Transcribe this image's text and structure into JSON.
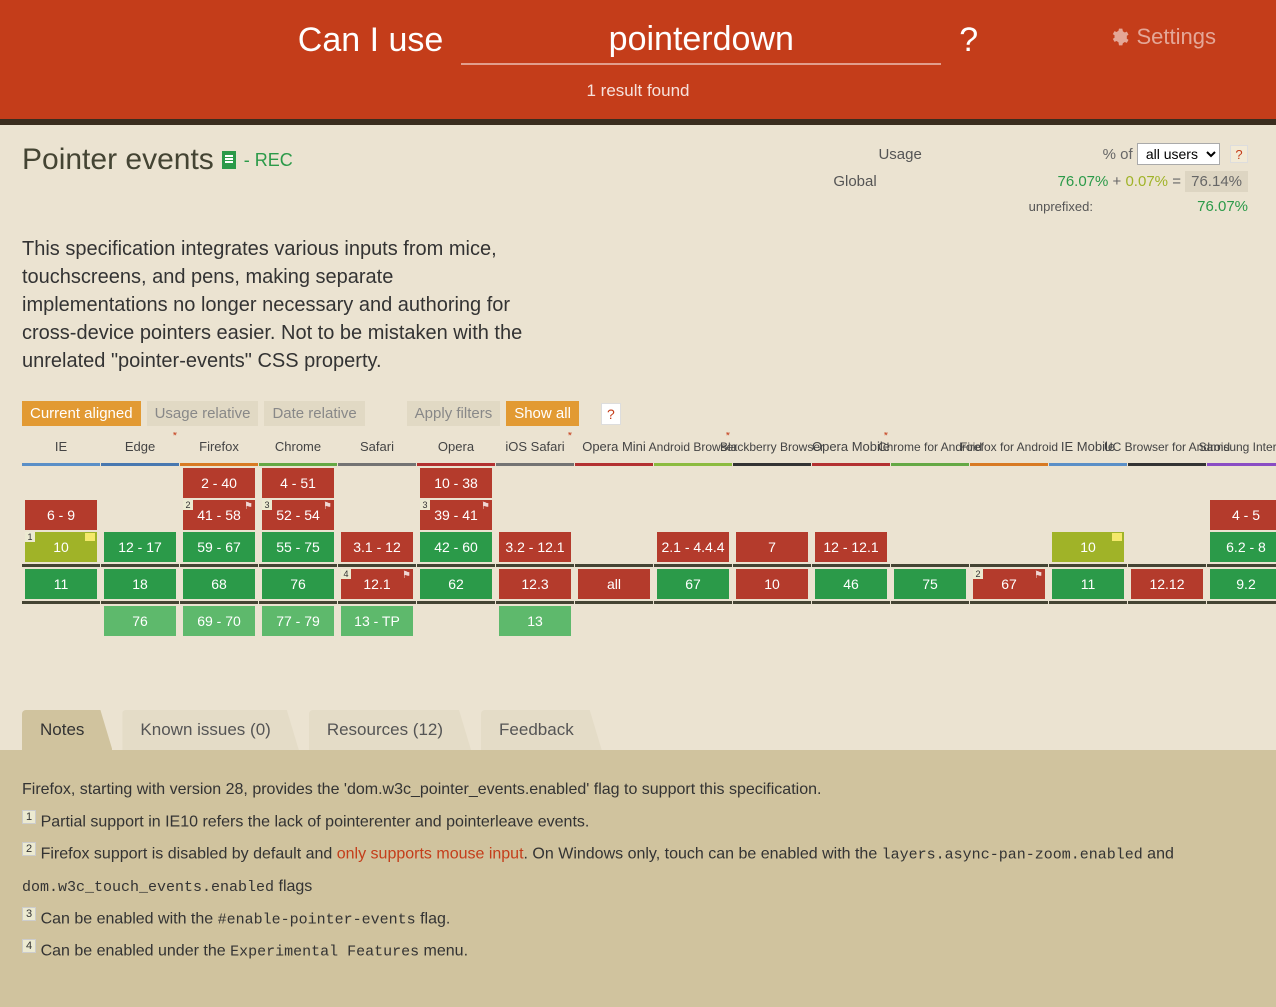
{
  "header": {
    "title_prefix": "Can I use",
    "search_value": "pointerdown",
    "qmark": "?",
    "settings_label": "Settings",
    "result_text": "1 result found"
  },
  "feature": {
    "title": "Pointer events",
    "status": "- REC",
    "description": "This specification integrates various inputs from mice, touchscreens, and pens, making separate implementations no longer necessary and authoring for cross-device pointers easier. Not to be mistaken with the unrelated \"pointer-events\" CSS property."
  },
  "usage": {
    "label": "Usage",
    "pct_of": "% of",
    "select_value": "all users",
    "help": "?",
    "global_label": "Global",
    "global_pct": "76.07%",
    "plus": "+",
    "prefix_pct": "0.07%",
    "eq": "=",
    "total_pct": "76.14%",
    "unprefixed_label": "unprefixed:",
    "unprefixed_pct": "76.07%"
  },
  "toolbar": {
    "current_aligned": "Current aligned",
    "usage_relative": "Usage relative",
    "date_relative": "Date relative",
    "apply_filters": "Apply filters",
    "show_all": "Show all",
    "help": "?"
  },
  "browsers": [
    {
      "name": "IE",
      "cls": "bc-ie",
      "star": false,
      "rows": [
        "",
        "6 - 9",
        "10",
        "11",
        ""
      ],
      "colors": [
        "empty",
        "red",
        "olive",
        "green",
        "empty"
      ],
      "marks": {
        "2": [
          "note:1",
          "minus"
        ]
      }
    },
    {
      "name": "Edge",
      "cls": "bc-edge",
      "star": true,
      "rows": [
        "",
        "",
        "12 - 17",
        "18",
        "76"
      ],
      "colors": [
        "empty",
        "empty",
        "green",
        "green",
        "lightgreen"
      ],
      "marks": {}
    },
    {
      "name": "Firefox",
      "cls": "bc-ff",
      "star": false,
      "rows": [
        "2 - 40",
        "41 - 58",
        "59 - 67",
        "68",
        "69 - 70"
      ],
      "colors": [
        "red",
        "red",
        "green",
        "green",
        "lightgreen"
      ],
      "marks": {
        "1": [
          "note:2",
          "flag"
        ]
      }
    },
    {
      "name": "Chrome",
      "cls": "bc-chrome",
      "star": false,
      "rows": [
        "4 - 51",
        "52 - 54",
        "55 - 75",
        "76",
        "77 - 79"
      ],
      "colors": [
        "red",
        "red",
        "green",
        "green",
        "lightgreen"
      ],
      "marks": {
        "1": [
          "note:3",
          "flag"
        ]
      }
    },
    {
      "name": "Safari",
      "cls": "bc-safari",
      "star": false,
      "rows": [
        "",
        "",
        "3.1 - 12",
        "12.1",
        "13 - TP"
      ],
      "colors": [
        "empty",
        "empty",
        "red",
        "red",
        "lightgreen"
      ],
      "marks": {
        "3": [
          "note:4",
          "flag"
        ]
      }
    },
    {
      "name": "Opera",
      "cls": "bc-opera",
      "star": false,
      "rows": [
        "10 - 38",
        "39 - 41",
        "42 - 60",
        "62",
        ""
      ],
      "colors": [
        "red",
        "red",
        "green",
        "green",
        "empty"
      ],
      "marks": {
        "1": [
          "note:3",
          "flag"
        ]
      }
    },
    {
      "name": "iOS Safari",
      "cls": "bc-ios",
      "star": true,
      "rows": [
        "",
        "",
        "3.2 - 12.1",
        "12.3",
        "13"
      ],
      "colors": [
        "empty",
        "empty",
        "red",
        "red",
        "lightgreen"
      ],
      "marks": {}
    },
    {
      "name": "Opera Mini",
      "cls": "bc-omini",
      "star": false,
      "rows": [
        "",
        "",
        "",
        "all",
        ""
      ],
      "colors": [
        "empty",
        "empty",
        "empty",
        "red",
        "empty"
      ],
      "marks": {}
    },
    {
      "name": "Android Browser",
      "cls": "bc-android",
      "star": true,
      "two": true,
      "rows": [
        "",
        "",
        "2.1 - 4.4.4",
        "67",
        ""
      ],
      "colors": [
        "empty",
        "empty",
        "red",
        "green",
        "empty"
      ],
      "marks": {}
    },
    {
      "name": "Blackberry Browser",
      "cls": "bc-bb",
      "star": false,
      "two": true,
      "rows": [
        "",
        "",
        "7",
        "10",
        ""
      ],
      "colors": [
        "empty",
        "empty",
        "red",
        "red",
        "empty"
      ],
      "marks": {}
    },
    {
      "name": "Opera Mobile",
      "cls": "bc-omob",
      "star": true,
      "rows": [
        "",
        "",
        "12 - 12.1",
        "46",
        ""
      ],
      "colors": [
        "empty",
        "empty",
        "red",
        "green",
        "empty"
      ],
      "marks": {}
    },
    {
      "name": "Chrome for Android",
      "cls": "bc-chrand",
      "star": false,
      "two": true,
      "rows": [
        "",
        "",
        "",
        "75",
        ""
      ],
      "colors": [
        "empty",
        "empty",
        "empty",
        "green",
        "empty"
      ],
      "marks": {}
    },
    {
      "name": "Firefox for Android",
      "cls": "bc-ffand",
      "star": false,
      "two": true,
      "rows": [
        "",
        "",
        "",
        "67",
        ""
      ],
      "colors": [
        "empty",
        "empty",
        "empty",
        "red",
        "empty"
      ],
      "marks": {
        "3": [
          "note:2",
          "flag"
        ]
      }
    },
    {
      "name": "IE Mobile",
      "cls": "bc-iemob",
      "star": false,
      "rows": [
        "",
        "",
        "10",
        "11",
        ""
      ],
      "colors": [
        "empty",
        "empty",
        "olive",
        "green",
        "empty"
      ],
      "marks": {
        "2": [
          "minus"
        ]
      }
    },
    {
      "name": "UC Browser for Android",
      "cls": "bc-uc",
      "star": false,
      "two": true,
      "rows": [
        "",
        "",
        "",
        "12.12",
        ""
      ],
      "colors": [
        "empty",
        "empty",
        "empty",
        "red",
        "empty"
      ],
      "marks": {}
    },
    {
      "name": "Samsung Internet",
      "cls": "bc-samsung",
      "star": false,
      "two": true,
      "rows": [
        "",
        "4 - 5",
        "6.2 - 8",
        "9.2",
        ""
      ],
      "colors": [
        "empty",
        "red",
        "green",
        "green",
        "empty"
      ],
      "marks": {}
    }
  ],
  "tabs": {
    "notes": "Notes",
    "issues": "Known issues (0)",
    "resources": "Resources (12)",
    "feedback": "Feedback"
  },
  "notes": {
    "intro": "Firefox, starting with version 28, provides the 'dom.w3c_pointer_events.enabled' flag to support this specification.",
    "n1": "Partial support in IE10 refers the lack of pointerenter and pointerleave events.",
    "n2a": "Firefox support is disabled by default and ",
    "n2link": "only supports mouse input",
    "n2b": ". On Windows only, touch can be enabled with the ",
    "n2code1": "layers.async-pan-zoom.enabled",
    "n2c": " and ",
    "n2code2": "dom.w3c_touch_events.enabled",
    "n2d": " flags",
    "n3a": "Can be enabled with the ",
    "n3code": "#enable-pointer-events",
    "n3b": " flag.",
    "n4a": "Can be enabled under the ",
    "n4code": "Experimental Features",
    "n4b": " menu."
  }
}
